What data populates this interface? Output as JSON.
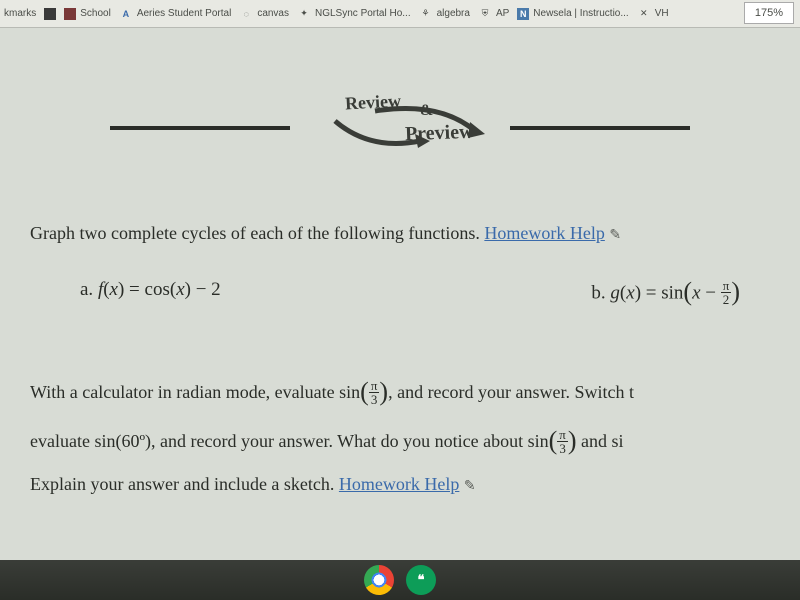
{
  "toolbar": {
    "bookmarks_label": "kmarks",
    "items": [
      {
        "label": "",
        "icon": "square"
      },
      {
        "label": "School",
        "icon": "square"
      },
      {
        "label": "Aeries Student Portal",
        "icon": "A"
      },
      {
        "label": "canvas",
        "icon": "circle"
      },
      {
        "label": "NGLSync Portal Ho...",
        "icon": "dots"
      },
      {
        "label": "algebra",
        "icon": "tree"
      },
      {
        "label": "AP",
        "icon": "shield"
      },
      {
        "label": "Newsela | Instructio...",
        "icon": "N"
      },
      {
        "label": "VH",
        "icon": "x"
      }
    ],
    "zoom": "175%"
  },
  "header": {
    "review": "Review",
    "and": "&",
    "preview": "Preview"
  },
  "problem1": {
    "intro": "Graph two complete cycles of each of the following functions. ",
    "link": "Homework Help",
    "eq_a_label": "a. ",
    "eq_a_fn": "f",
    "eq_a_var": "x",
    "eq_a_rhs1": "cos",
    "eq_a_rhs2": " − 2",
    "eq_b_label": "b. ",
    "eq_b_fn": "g",
    "eq_b_var": "x",
    "eq_b_rhs1": "sin",
    "eq_b_frac_num": "π",
    "eq_b_frac_den": "2"
  },
  "problem2": {
    "text1": "With a calculator in radian mode, evaluate sin",
    "frac1_num": "π",
    "frac1_den": "3",
    "text2": ", and record your answer. Switch t",
    "text3": "evaluate sin(60º), and record your answer. What do you notice about sin",
    "frac2_num": "π",
    "frac2_den": "3",
    "text4": " and si",
    "text5": "Explain your answer and include a sketch. ",
    "link": "Homework Help"
  },
  "taskbar": {
    "hangouts_glyph": "❝"
  }
}
